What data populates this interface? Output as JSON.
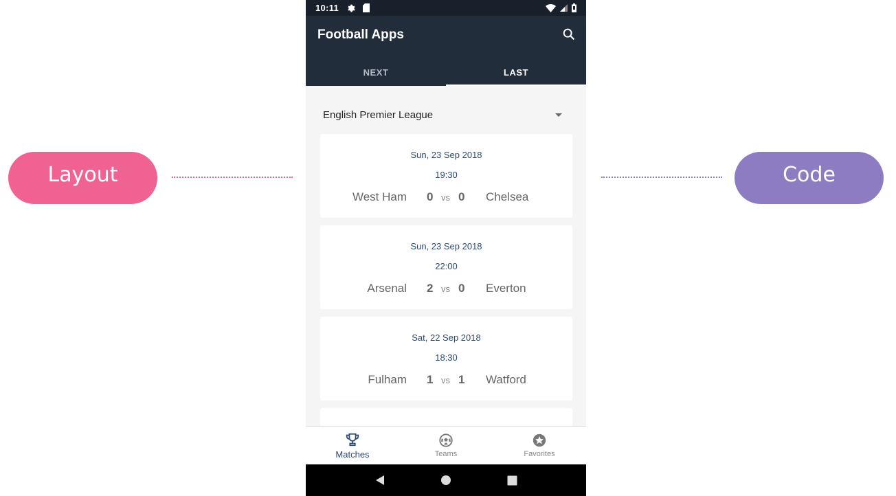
{
  "side_labels": {
    "left": "Layout",
    "right": "Code",
    "left_color": "#f06292",
    "right_color": "#8e7cc3"
  },
  "status_bar": {
    "time": "10:11",
    "icons": [
      "gear-icon",
      "sim-card-icon",
      "wifi-icon",
      "signal-icon",
      "battery-icon"
    ]
  },
  "app_bar": {
    "title": "Football Apps",
    "search_icon": "search-icon",
    "color": "#222d3c"
  },
  "tabs": [
    {
      "label": "NEXT",
      "active": false
    },
    {
      "label": "LAST",
      "active": true
    }
  ],
  "league_select": {
    "selected": "English Premier League"
  },
  "matches": [
    {
      "date": "Sun, 23 Sep 2018",
      "time": "19:30",
      "home": "West Ham",
      "home_score": "0",
      "vs": "vs",
      "away_score": "0",
      "away": "Chelsea"
    },
    {
      "date": "Sun, 23 Sep 2018",
      "time": "22:00",
      "home": "Arsenal",
      "home_score": "2",
      "vs": "vs",
      "away_score": "0",
      "away": "Everton"
    },
    {
      "date": "Sat, 22 Sep 2018",
      "time": "18:30",
      "home": "Fulham",
      "home_score": "1",
      "vs": "vs",
      "away_score": "1",
      "away": "Watford"
    }
  ],
  "bottom_nav": [
    {
      "label": "Matches",
      "icon": "trophy-icon",
      "active": true
    },
    {
      "label": "Teams",
      "icon": "soccer-ball-icon",
      "active": false
    },
    {
      "label": "Favorites",
      "icon": "star-circle-icon",
      "active": false
    }
  ],
  "system_nav": [
    "back-icon",
    "home-icon",
    "recents-icon"
  ]
}
